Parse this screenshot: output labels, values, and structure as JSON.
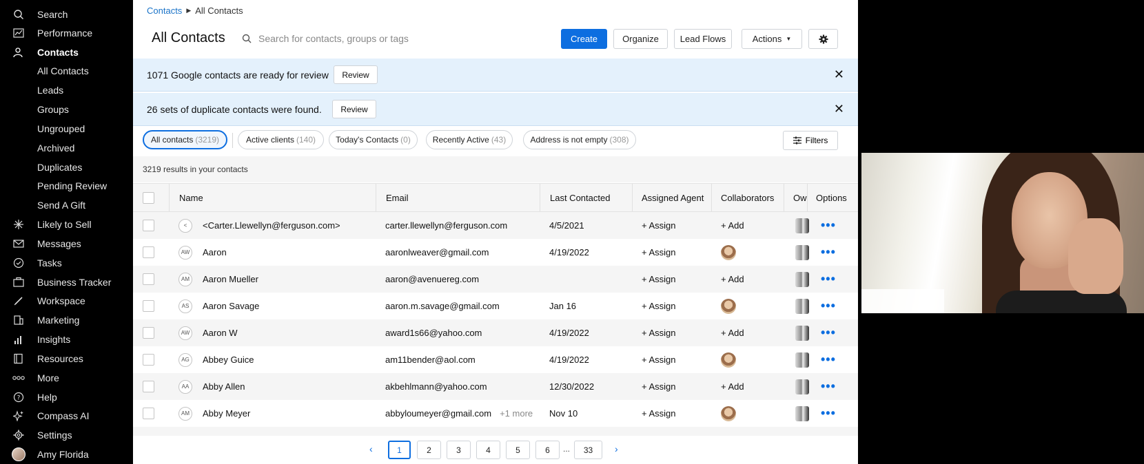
{
  "sidebar": {
    "items": [
      {
        "label": "Search",
        "icon": "search-icon"
      },
      {
        "label": "Performance",
        "icon": "chart-icon"
      },
      {
        "label": "Contacts",
        "icon": "contacts-icon"
      },
      {
        "label": "All Contacts"
      },
      {
        "label": "Leads"
      },
      {
        "label": "Groups"
      },
      {
        "label": "Ungrouped"
      },
      {
        "label": "Archived"
      },
      {
        "label": "Duplicates"
      },
      {
        "label": "Pending Review"
      },
      {
        "label": "Send A Gift"
      },
      {
        "label": "Likely to Sell",
        "icon": "sparkle-icon"
      },
      {
        "label": "Messages",
        "icon": "mail-icon"
      },
      {
        "label": "Tasks",
        "icon": "check-circle-icon"
      },
      {
        "label": "Business Tracker",
        "icon": "briefcase-icon"
      },
      {
        "label": "Workspace",
        "icon": "pencil-icon"
      },
      {
        "label": "Marketing",
        "icon": "marketing-icon"
      },
      {
        "label": "Insights",
        "icon": "bar-chart-icon"
      },
      {
        "label": "Resources",
        "icon": "book-icon"
      },
      {
        "label": "More",
        "icon": "dots-icon"
      },
      {
        "label": "Help",
        "icon": "help-icon"
      },
      {
        "label": "Compass AI",
        "icon": "ai-sparkle-icon"
      },
      {
        "label": "Settings",
        "icon": "gear-icon"
      },
      {
        "label": "Amy Florida",
        "icon": "avatar"
      }
    ]
  },
  "breadcrumb": {
    "link": "Contacts",
    "current": "All Contacts"
  },
  "header": {
    "title": "All Contacts",
    "search_placeholder": "Search for contacts, groups or tags",
    "create": "Create",
    "organize": "Organize",
    "lead_flows": "Lead Flows",
    "actions": "Actions"
  },
  "banners": [
    {
      "text": "1071 Google contacts are ready for review",
      "button": "Review",
      "close": "✕"
    },
    {
      "text": "26 sets of duplicate contacts were found.",
      "button": "Review",
      "close": "✕"
    }
  ],
  "filters": {
    "chips": [
      {
        "label": "All contacts",
        "count": "(3219)"
      },
      {
        "label": "Active clients",
        "count": "(140)"
      },
      {
        "label": "Today's Contacts",
        "count": "(0)"
      },
      {
        "label": "Recently Active",
        "count": "(43)"
      },
      {
        "label": "Address is not empty",
        "count": "(308)"
      }
    ],
    "filters_button": "Filters"
  },
  "results_text": "3219 results in your contacts",
  "table": {
    "columns": [
      "Name",
      "Email",
      "Last Contacted",
      "Assigned Agent",
      "Collaborators",
      "Ow",
      "Options"
    ],
    "rows": [
      {
        "initials": "<",
        "name": "<Carter.Llewellyn@ferguson.com>",
        "email": "carter.llewellyn@ferguson.com",
        "more": "",
        "last": "4/5/2021",
        "agent": "+ Assign",
        "collab": "+ Add"
      },
      {
        "initials": "AW",
        "name": "Aaron",
        "email": "aaronlweaver@gmail.com",
        "more": "",
        "last": "4/19/2022",
        "agent": "+ Assign",
        "collab": ""
      },
      {
        "initials": "AM",
        "name": "Aaron Mueller",
        "email": "aaron@avenuereg.com",
        "more": "",
        "last": "",
        "agent": "+ Assign",
        "collab": "+ Add"
      },
      {
        "initials": "AS",
        "name": "Aaron Savage",
        "email": "aaron.m.savage@gmail.com",
        "more": "",
        "last": "Jan 16",
        "agent": "+ Assign",
        "collab": ""
      },
      {
        "initials": "AW",
        "name": "Aaron W",
        "email": "award1s66@yahoo.com",
        "more": "",
        "last": "4/19/2022",
        "agent": "+ Assign",
        "collab": "+ Add"
      },
      {
        "initials": "AG",
        "name": "Abbey Guice",
        "email": "am11bender@aol.com",
        "more": "",
        "last": "4/19/2022",
        "agent": "+ Assign",
        "collab": ""
      },
      {
        "initials": "AA",
        "name": "Abby Allen",
        "email": "akbehlmann@yahoo.com",
        "more": "",
        "last": "12/30/2022",
        "agent": "+ Assign",
        "collab": "+ Add"
      },
      {
        "initials": "AM",
        "name": "Abby Meyer",
        "email": "abbyloumeyer@gmail.com",
        "more": "+1 more",
        "last": "Nov 10",
        "agent": "+ Assign",
        "collab": ""
      }
    ]
  },
  "pagination": {
    "pages": [
      "1",
      "2",
      "3",
      "4",
      "5",
      "6"
    ],
    "ellipsis": "...",
    "last": "33",
    "prev": "‹",
    "next": "›"
  },
  "colors": {
    "accent": "#0d6ee0",
    "banner": "#e4f1fc",
    "sidebar": "#000000"
  }
}
